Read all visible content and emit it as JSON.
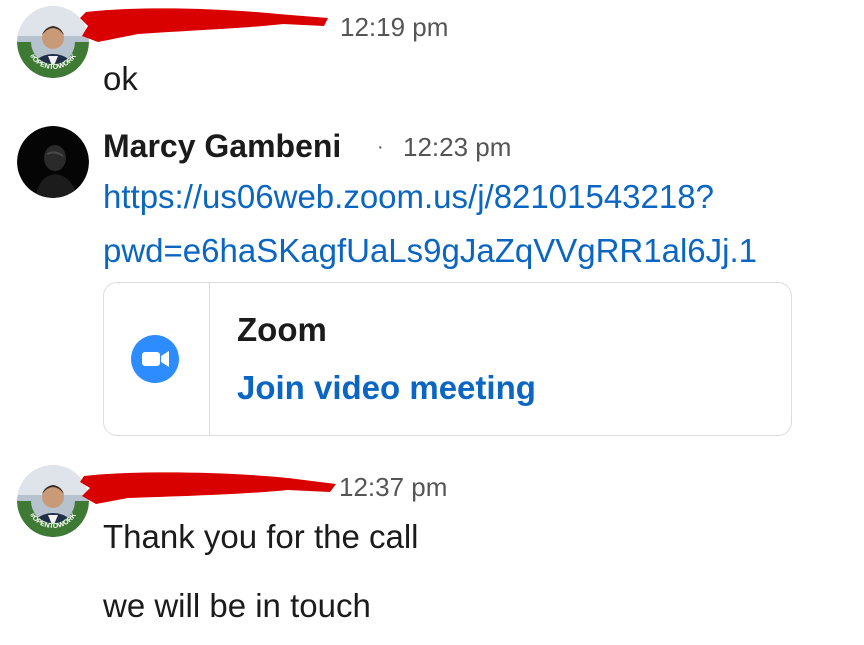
{
  "messages": [
    {
      "sender_redacted": true,
      "avatar_badge": "#OPENTOWORK",
      "time": "12:19 pm",
      "lines": [
        "ok"
      ]
    },
    {
      "sender": "Marcy Gambeni",
      "separator": "·",
      "time": "12:23 pm",
      "link_lines": [
        "https://us06web.zoom.us/j/82101543218?",
        "pwd=e6haSKagfUaLs9gJaZqVVgRR1al6Jj.1"
      ],
      "card": {
        "icon": "zoom-camera-icon",
        "title": "Zoom",
        "action": "Join video meeting"
      }
    },
    {
      "sender_redacted": true,
      "avatar_badge": "#OPENTOWORK",
      "time": "12:37 pm",
      "lines": [
        "Thank you for the call",
        "we will be in touch"
      ]
    }
  ],
  "colors": {
    "link": "#0a66c2",
    "zoom_blue": "#2d8cff",
    "opentowork_green": "#3e7a34",
    "redaction": "#d90000"
  }
}
